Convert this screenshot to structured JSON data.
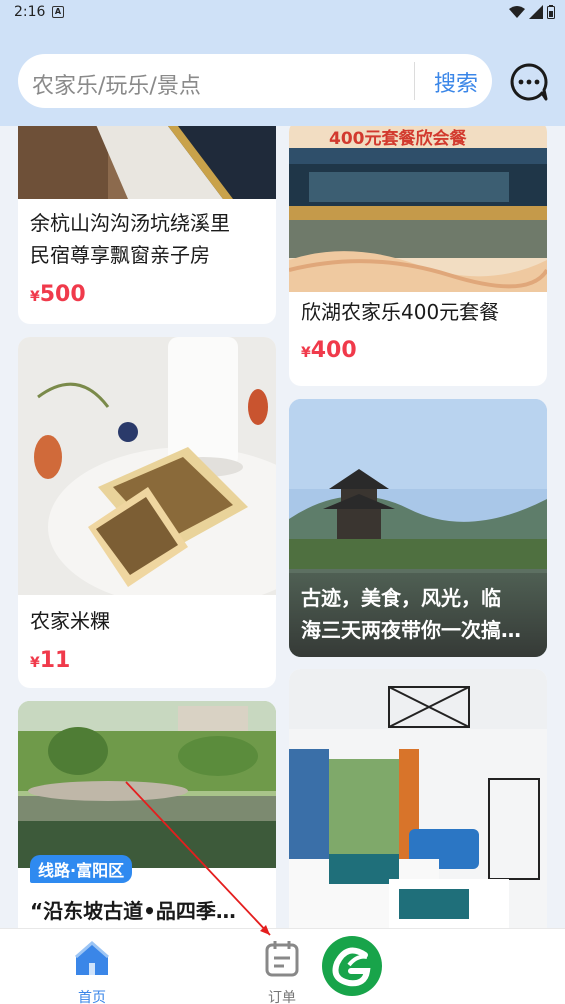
{
  "status_bar": {
    "time": "2:16",
    "app_icon": "A"
  },
  "search": {
    "placeholder": "农家乐/玩乐/景点",
    "button_label": "搜索"
  },
  "feed": {
    "left": [
      {
        "title_line1": "余杭山沟沟汤坑绕溪里",
        "title_line2": "民宿尊享飘窗亲子房",
        "currency": "¥",
        "price": "500"
      },
      {
        "title_line1": "农家米粿",
        "currency": "¥",
        "price": "11"
      },
      {
        "badge": "线路·富阳区",
        "title_line1": "“沿东坡古道•品四季…"
      }
    ],
    "right": [
      {
        "banner_text": "400元套餐欣会餐",
        "title_line1": "欣湖农家乐400元套餐",
        "currency": "¥",
        "price": "400"
      },
      {
        "title_line1": "古迹，美食，风光，临",
        "title_line2": "海三天两夜带你一次搞…"
      },
      {
        "title_line1": ""
      }
    ]
  },
  "tabbar": {
    "home_label": "首页",
    "orders_label": "订单"
  },
  "colors": {
    "accent": "#3a86e8",
    "price": "#f03a4b",
    "header_bg": "#cfe1f7"
  }
}
